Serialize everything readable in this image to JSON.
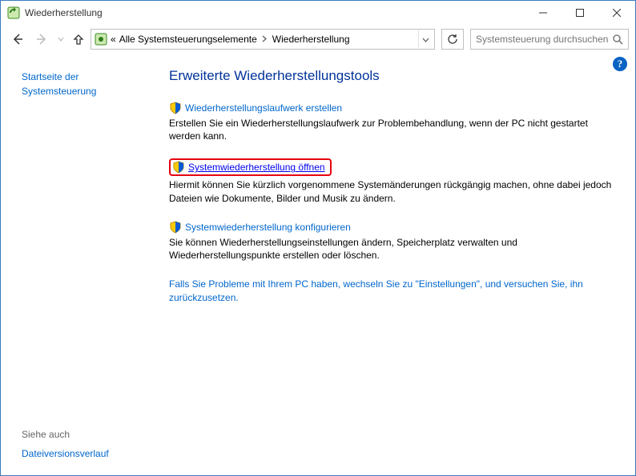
{
  "window": {
    "title": "Wiederherstellung"
  },
  "breadcrumb": {
    "root_symbol": "«",
    "parent": "Alle Systemsteuerungselemente",
    "current": "Wiederherstellung"
  },
  "search": {
    "placeholder": "Systemsteuerung durchsuchen"
  },
  "sidebar": {
    "home_link": "Startseite der Systemsteuerung"
  },
  "main": {
    "heading": "Erweiterte Wiederherstellungstools",
    "tasks": [
      {
        "title": "Wiederherstellungslaufwerk erstellen",
        "description": "Erstellen Sie ein Wiederherstellungslaufwerk zur Problembehandlung, wenn der PC nicht gestartet werden kann."
      },
      {
        "title": "Systemwiederherstellung öffnen",
        "description": "Hiermit können Sie kürzlich vorgenommene Systemänderungen rückgängig machen, ohne dabei jedoch Dateien wie Dokumente, Bilder und Musik zu ändern."
      },
      {
        "title": "Systemwiederherstellung konfigurieren",
        "description": "Sie können Wiederherstellungseinstellungen ändern, Speicherplatz verwalten und Wiederherstellungspunkte erstellen oder löschen."
      }
    ],
    "extra_link": "Falls Sie Probleme mit Ihrem PC haben, wechseln Sie zu \"Einstellungen\", und versuchen Sie, ihn zurückzusetzen."
  },
  "see_also": {
    "title": "Siehe auch",
    "link": "Dateiversionsverlauf"
  },
  "help_glyph": "?"
}
